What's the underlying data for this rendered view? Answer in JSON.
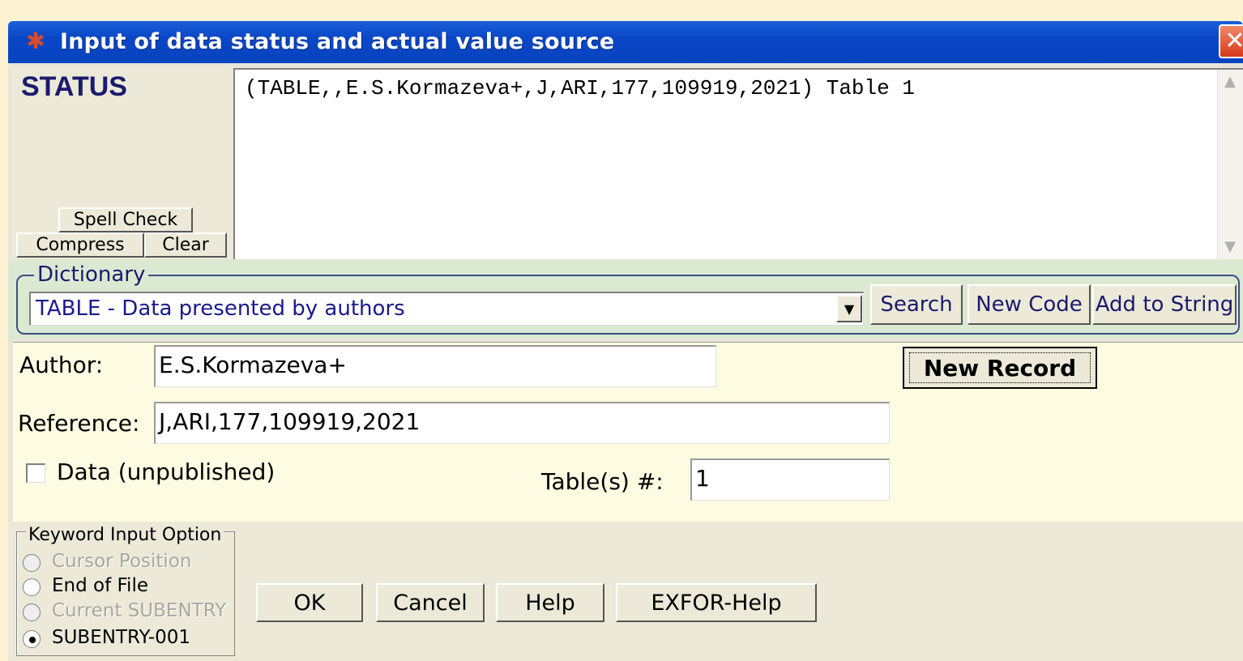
{
  "window": {
    "title": "Input of data status and actual value source",
    "close_glyph": "✕",
    "icon": "atom-icon"
  },
  "status": {
    "label": "STATUS",
    "text": "(TABLE,,E.S.Kormazeva+,J,ARI,177,109919,2021) Table 1",
    "spell_check_label": "Spell Check",
    "compress_label": "Compress",
    "clear_label": "Clear"
  },
  "dictionary": {
    "label": "Dictionary",
    "selected": "TABLE - Data presented by authors",
    "search_label": "Search",
    "new_code_label": "New Code",
    "add_to_string_label": "Add to String"
  },
  "reference": {
    "author_label": "Author:",
    "author_value": "E.S.Kormazeva+",
    "new_record_label": "New Record",
    "reference_label": "Reference:",
    "reference_value": "J,ARI,177,109919,2021",
    "unpublished_label": "Data (unpublished)",
    "unpublished_checked": false,
    "tables_label": "Table(s) #:",
    "tables_value": "1"
  },
  "keyword_option": {
    "label": "Keyword Input Option",
    "options": [
      {
        "label": "Cursor Position",
        "enabled": false,
        "selected": false
      },
      {
        "label": "End of File",
        "enabled": true,
        "selected": false
      },
      {
        "label": "Current SUBENTRY",
        "enabled": false,
        "selected": false
      },
      {
        "label": "SUBENTRY-001",
        "enabled": true,
        "selected": true
      }
    ]
  },
  "actions": {
    "ok_label": "OK",
    "cancel_label": "Cancel",
    "help_label": "Help",
    "exfor_help_label": "EXFOR-Help"
  },
  "colors": {
    "titlebar": "#0a47c6",
    "background": "#fdf2d2",
    "dictionary_bg": "#dbe9d2",
    "reference_bg": "#fdfbe2",
    "label_blue": "#1a1a6e"
  }
}
